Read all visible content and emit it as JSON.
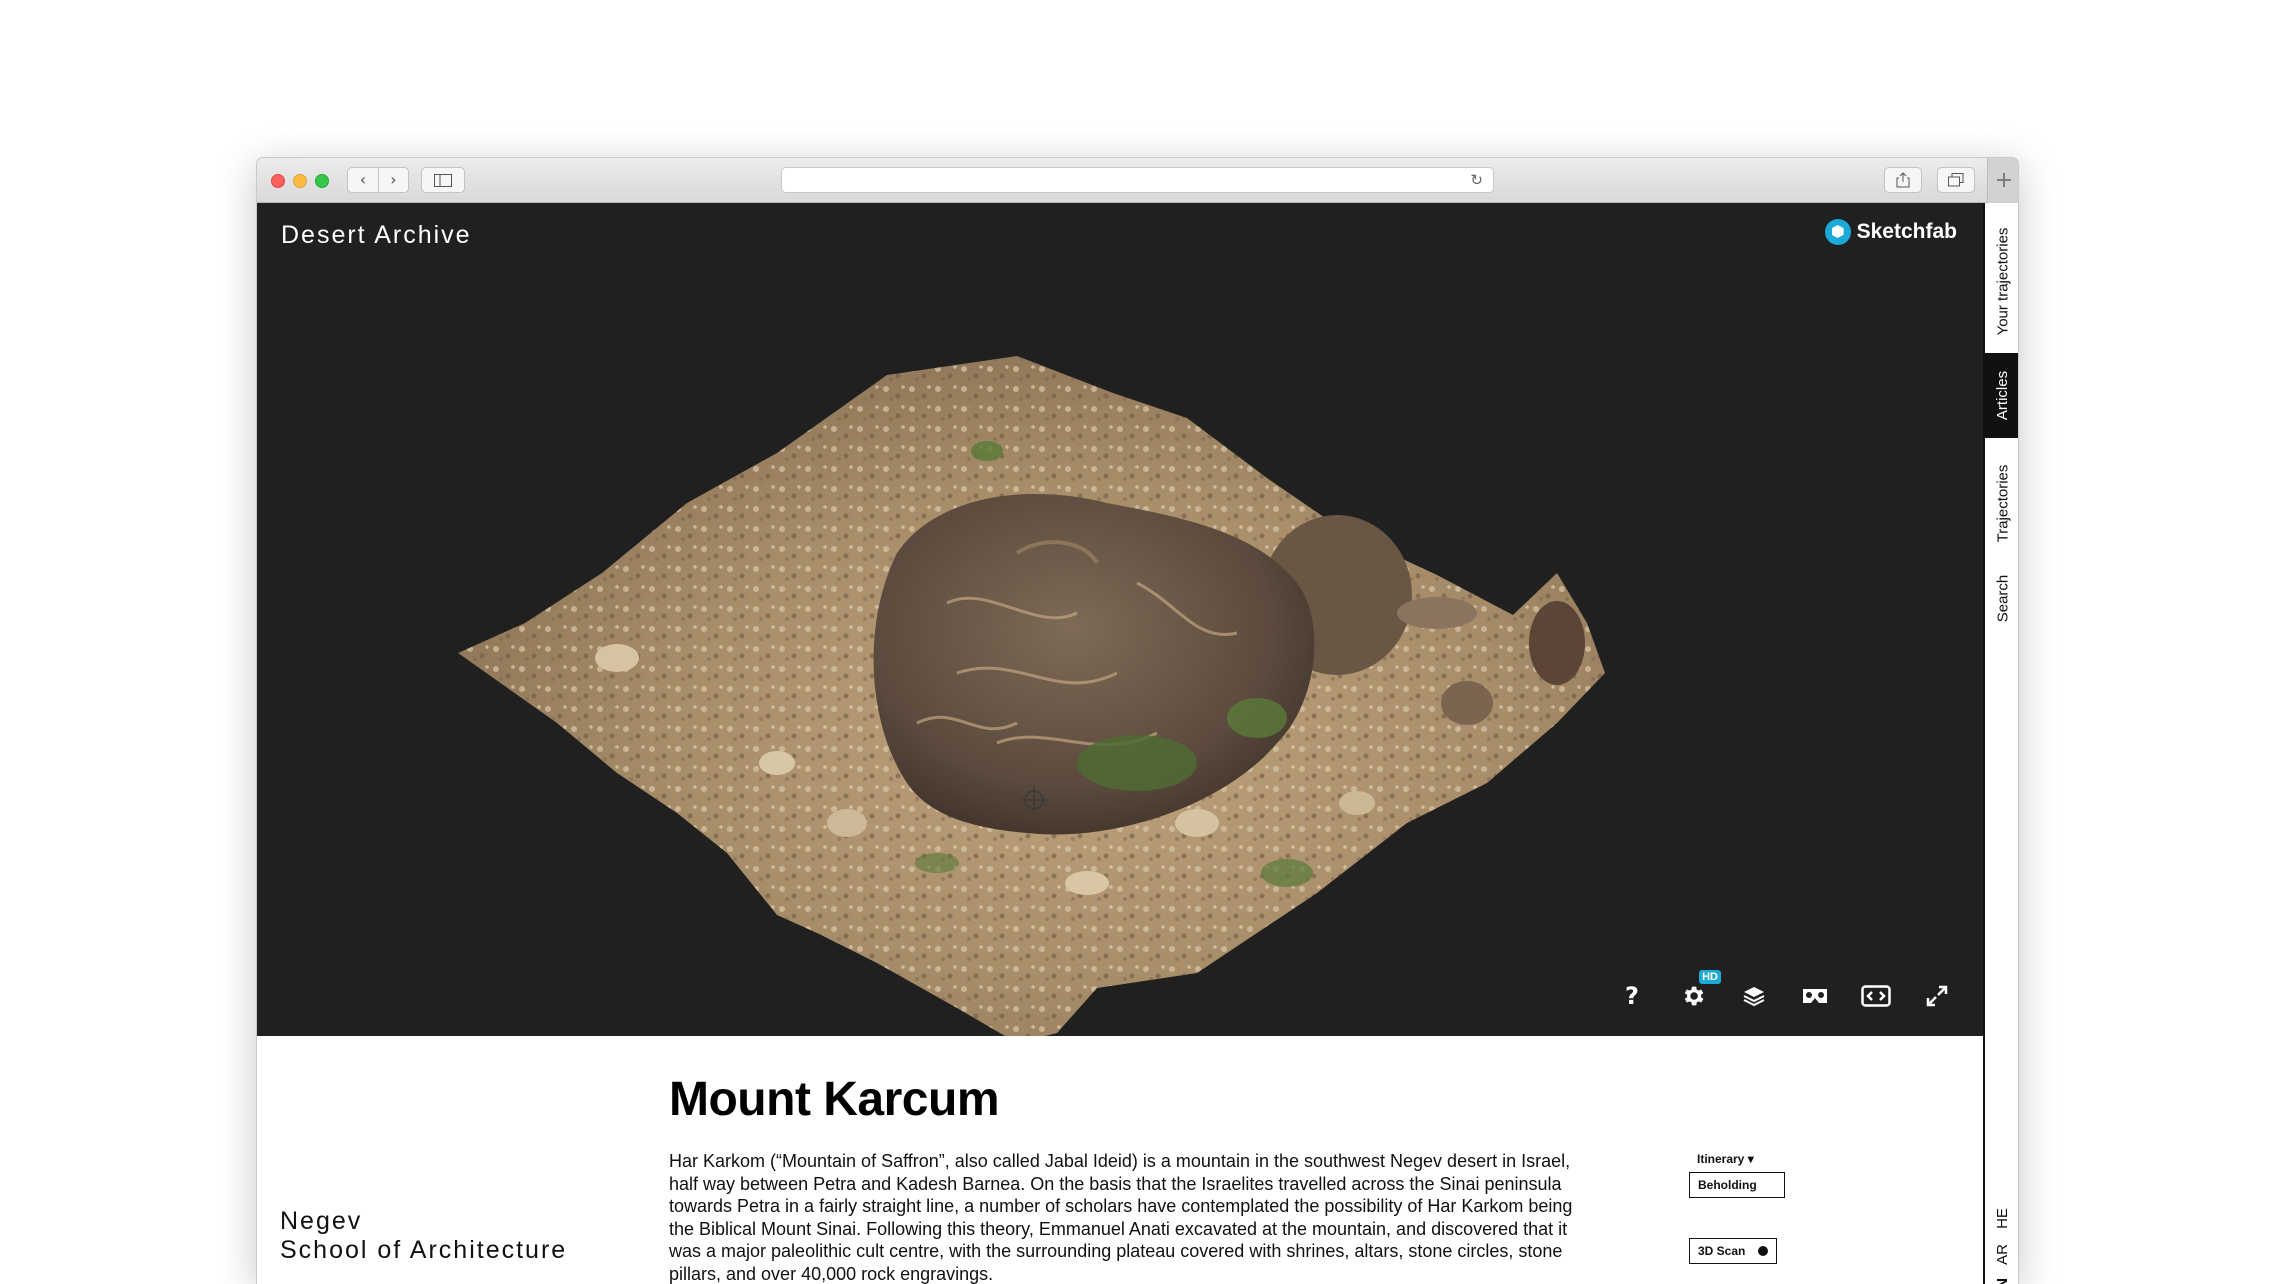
{
  "site": {
    "title": "Desert Archive",
    "institution_line1": "Negev",
    "institution_line2": "School of Architecture"
  },
  "viewer": {
    "brand": "Sketchfab",
    "brand_color": "#1caad9",
    "background_color": "#202020",
    "hd_badge": "HD",
    "help_label": "?",
    "controls": [
      "help-icon",
      "settings-icon",
      "layers-icon",
      "vr-headset-icon",
      "embed-icon",
      "fullscreen-icon"
    ]
  },
  "nav": {
    "tabs": [
      "Your trajectories",
      "Articles",
      "Trajectories",
      "Search"
    ],
    "active_tab": "Articles",
    "languages": [
      "HE",
      "AR",
      "EN"
    ]
  },
  "article": {
    "title": "Mount Karcum",
    "body": "Har Karkom (“Mountain of Saffron”, also called Jabal Ideid) is a mountain in the southwest Negev desert in Israel, half way between Petra and Kadesh Barnea. On the basis that the Israelites travelled across the Sinai peninsula towards Petra in a fairly straight line, a number of scholars have contemplated the possibility of Har Karkom being the Biblical Mount Sinai. Following this theory, Emmanuel Anati excavated at the mountain, and discovered that it was a major paleolithic cult centre, with the surrounding plateau covered with shrines, altars, stone circles, stone pillars, and over 40,000 rock engravings."
  },
  "meta": {
    "itinerary_label": "Itinerary ▾",
    "itinerary_value": "Beholding",
    "scan_label": "3D Scan"
  }
}
